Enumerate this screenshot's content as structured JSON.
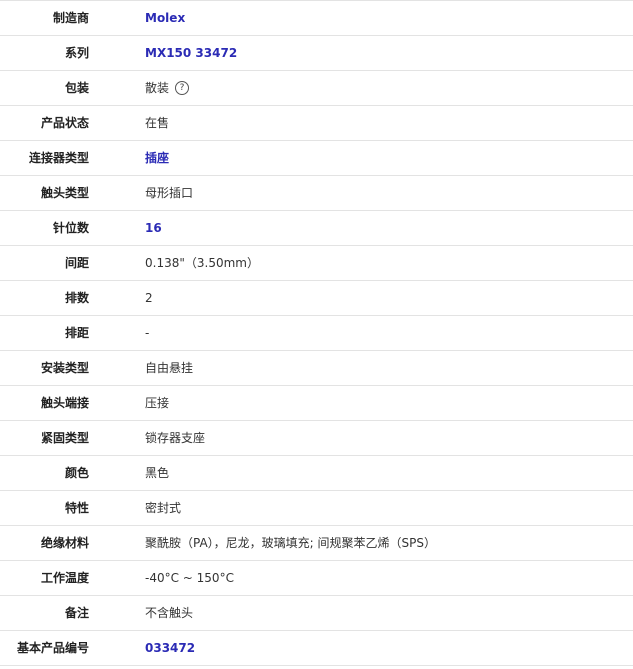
{
  "specs": [
    {
      "label": "制造商",
      "value": "Molex",
      "link": true
    },
    {
      "label": "系列",
      "value": "MX150 33472",
      "link": true
    },
    {
      "label": "包装",
      "value": "散装",
      "link": false,
      "help_icon": "help-circle-icon"
    },
    {
      "label": "产品状态",
      "value": "在售",
      "link": false
    },
    {
      "label": "连接器类型",
      "value": "插座",
      "link": true
    },
    {
      "label": "触头类型",
      "value": "母形插口",
      "link": false
    },
    {
      "label": "针位数",
      "value": "16",
      "link": true
    },
    {
      "label": "间距",
      "value": "0.138\"（3.50mm）",
      "link": false
    },
    {
      "label": "排数",
      "value": "2",
      "link": false
    },
    {
      "label": "排距",
      "value": "-",
      "link": false
    },
    {
      "label": "安装类型",
      "value": "自由悬挂",
      "link": false
    },
    {
      "label": "触头端接",
      "value": "压接",
      "link": false
    },
    {
      "label": "紧固类型",
      "value": "锁存器支座",
      "link": false
    },
    {
      "label": "颜色",
      "value": "黑色",
      "link": false
    },
    {
      "label": "特性",
      "value": "密封式",
      "link": false
    },
    {
      "label": "绝缘材料",
      "value": "聚酰胺（PA），尼龙，玻璃填充; 间规聚苯乙烯（SPS）",
      "link": false
    },
    {
      "label": "工作温度",
      "value": "-40°C ~ 150°C",
      "link": false
    },
    {
      "label": "备注",
      "value": "不含触头",
      "link": false
    },
    {
      "label": "基本产品编号",
      "value": "033472",
      "link": true
    }
  ],
  "colors": {
    "link": "#2b2bb5",
    "border": "#e3e3e3",
    "label": "#222222",
    "value": "#333333"
  },
  "help_glyph": "?"
}
